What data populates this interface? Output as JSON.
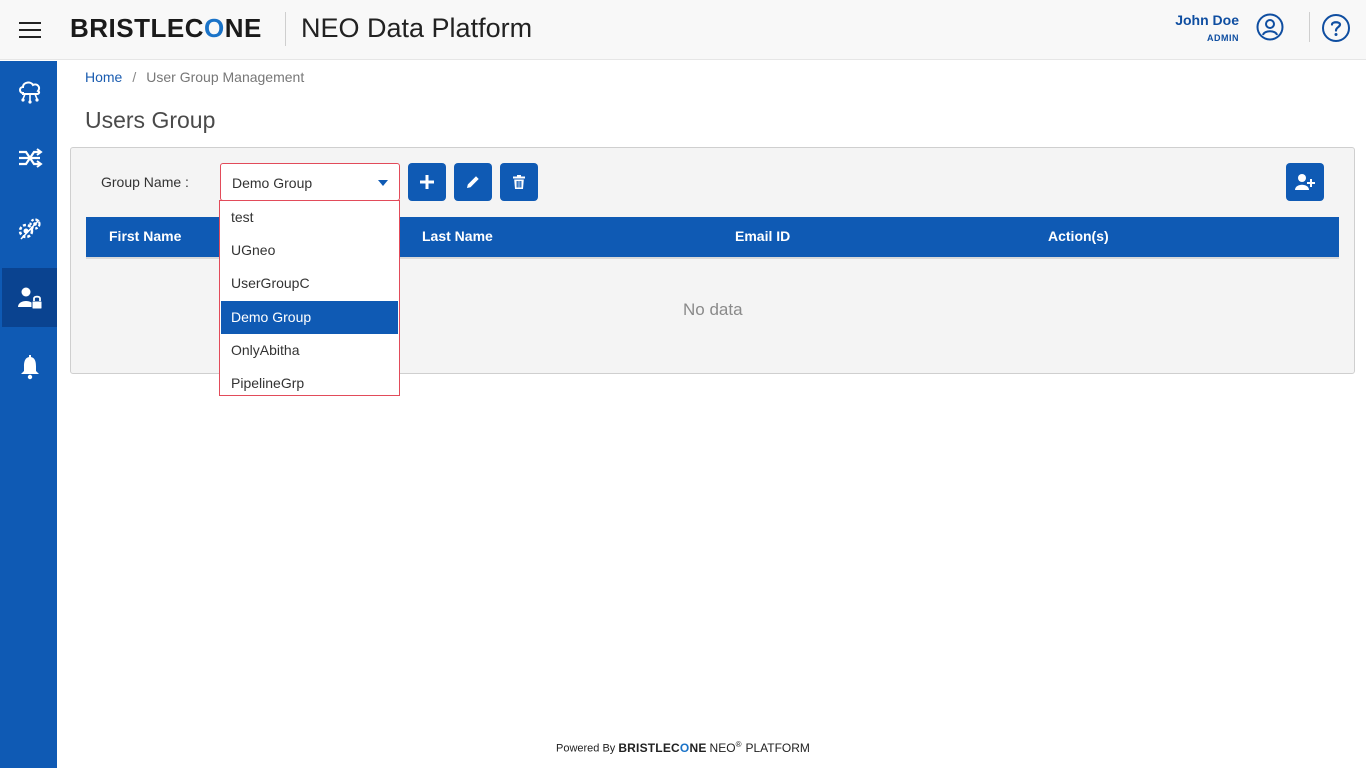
{
  "header": {
    "brand_pre": "BRISTLEC",
    "brand_o": "O",
    "brand_post": "NE",
    "app_title": "NEO Data Platform",
    "user_name": "John Doe",
    "user_role": "ADMIN"
  },
  "sidebar": {
    "items": [
      {
        "icon": "cloud-network-icon"
      },
      {
        "icon": "shuffle-arrows-icon"
      },
      {
        "icon": "gears-icon"
      },
      {
        "icon": "user-lock-icon",
        "active": true
      },
      {
        "icon": "bell-icon"
      }
    ]
  },
  "breadcrumb": {
    "home": "Home",
    "separator": "/",
    "current": "User Group Management"
  },
  "page": {
    "title": "Users Group"
  },
  "filter": {
    "label": "Group Name :",
    "selected": "Demo Group",
    "options": [
      "test",
      "UGneo",
      "UserGroupC",
      "Demo Group",
      "OnlyAbitha",
      "PipelineGrp"
    ]
  },
  "actions": {
    "add": "plus-icon",
    "edit": "pencil-icon",
    "delete": "trash-icon",
    "add_user": "user-plus-icon"
  },
  "table": {
    "columns": [
      "First Name",
      "Last Name",
      "Email ID",
      "Action(s)"
    ],
    "rows": [],
    "empty_text": "No data"
  },
  "footer": {
    "powered_by": "Powered By",
    "brand_pre": "BRISTLEC",
    "brand_o": "O",
    "brand_post": "NE",
    "neo": "NEO",
    "reg": "®",
    "platform": "PLATFORM"
  },
  "colors": {
    "primary": "#0f5ab4",
    "sidebar_active": "#0a4390",
    "dropdown_border": "#e24b5a"
  }
}
